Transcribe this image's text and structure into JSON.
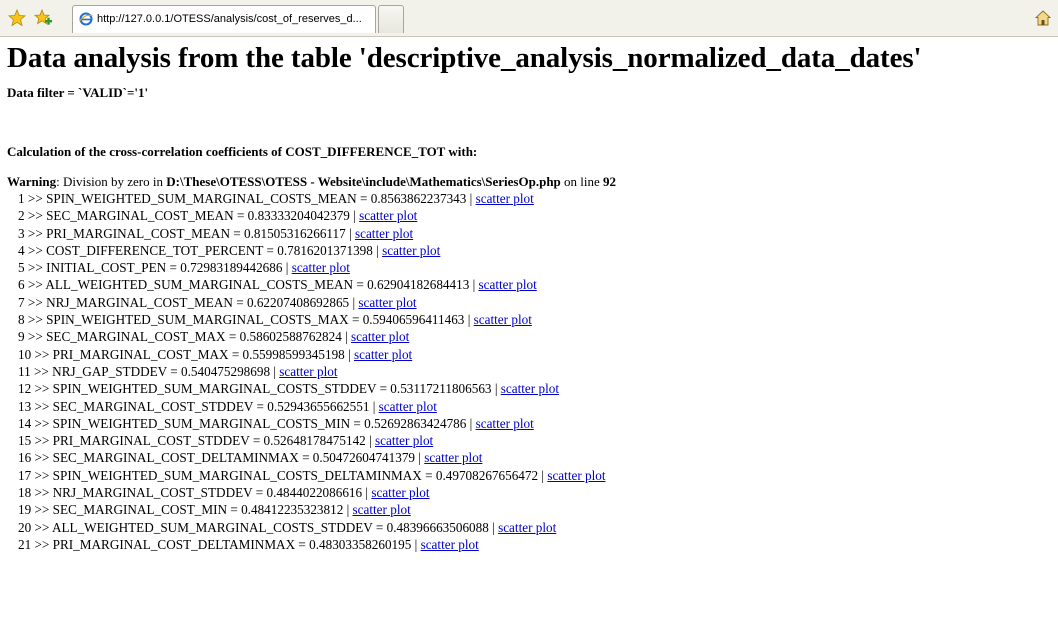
{
  "browser": {
    "tab_title": "http://127.0.0.1/OTESS/analysis/cost_of_reserves_d..."
  },
  "page": {
    "title": "Data analysis from the table 'descriptive_analysis_normalized_data_dates'",
    "filter_text": "Data filter = `VALID`='1'",
    "calc_heading": "Calculation of the cross-correlation coefficients of COST_DIFFERENCE_TOT with:"
  },
  "warning": {
    "label": "Warning",
    "text_1": ": Division by zero in ",
    "path": "D:\\These\\OTESS\\OTESS - Website\\include\\Mathematics\\SeriesOp.php",
    "text_2": " on line ",
    "line": "92"
  },
  "results": [
    {
      "rank": "1",
      "name": "SPIN_WEIGHTED_SUM_MARGINAL_COSTS_MEAN",
      "value": "0.8563862237343",
      "link": "scatter plot"
    },
    {
      "rank": "2",
      "name": "SEC_MARGINAL_COST_MEAN",
      "value": "0.83333204042379",
      "link": "scatter plot"
    },
    {
      "rank": "3",
      "name": "PRI_MARGINAL_COST_MEAN",
      "value": "0.81505316266117",
      "link": "scatter plot"
    },
    {
      "rank": "4",
      "name": "COST_DIFFERENCE_TOT_PERCENT",
      "value": "0.7816201371398",
      "link": "scatter plot"
    },
    {
      "rank": "5",
      "name": "INITIAL_COST_PEN",
      "value": "0.72983189442686",
      "link": "scatter plot"
    },
    {
      "rank": "6",
      "name": "ALL_WEIGHTED_SUM_MARGINAL_COSTS_MEAN",
      "value": "0.62904182684413",
      "link": "scatter plot"
    },
    {
      "rank": "7",
      "name": "NRJ_MARGINAL_COST_MEAN",
      "value": "0.62207408692865",
      "link": "scatter plot"
    },
    {
      "rank": "8",
      "name": "SPIN_WEIGHTED_SUM_MARGINAL_COSTS_MAX",
      "value": "0.59406596411463",
      "link": "scatter plot"
    },
    {
      "rank": "9",
      "name": "SEC_MARGINAL_COST_MAX",
      "value": "0.58602588762824",
      "link": "scatter plot"
    },
    {
      "rank": "10",
      "name": "PRI_MARGINAL_COST_MAX",
      "value": "0.55998599345198",
      "link": "scatter plot"
    },
    {
      "rank": "11",
      "name": "NRJ_GAP_STDDEV",
      "value": "0.540475298698",
      "link": "scatter plot"
    },
    {
      "rank": "12",
      "name": "SPIN_WEIGHTED_SUM_MARGINAL_COSTS_STDDEV",
      "value": "0.53117211806563",
      "link": "scatter plot"
    },
    {
      "rank": "13",
      "name": "SEC_MARGINAL_COST_STDDEV",
      "value": "0.52943655662551",
      "link": "scatter plot"
    },
    {
      "rank": "14",
      "name": "SPIN_WEIGHTED_SUM_MARGINAL_COSTS_MIN",
      "value": "0.52692863424786",
      "link": "scatter plot"
    },
    {
      "rank": "15",
      "name": "PRI_MARGINAL_COST_STDDEV",
      "value": "0.52648178475142",
      "link": "scatter plot"
    },
    {
      "rank": "16",
      "name": "SEC_MARGINAL_COST_DELTAMINMAX",
      "value": "0.50472604741379",
      "link": "scatter plot"
    },
    {
      "rank": "17",
      "name": "SPIN_WEIGHTED_SUM_MARGINAL_COSTS_DELTAMINMAX",
      "value": "0.49708267656472",
      "link": "scatter plot"
    },
    {
      "rank": "18",
      "name": "NRJ_MARGINAL_COST_STDDEV",
      "value": "0.4844022086616",
      "link": "scatter plot"
    },
    {
      "rank": "19",
      "name": "SEC_MARGINAL_COST_MIN",
      "value": "0.48412235323812",
      "link": "scatter plot"
    },
    {
      "rank": "20",
      "name": "ALL_WEIGHTED_SUM_MARGINAL_COSTS_STDDEV",
      "value": "0.48396663506088",
      "link": "scatter plot"
    },
    {
      "rank": "21",
      "name": "PRI_MARGINAL_COST_DELTAMINMAX",
      "value": "0.48303358260195",
      "link": "scatter plot"
    }
  ]
}
